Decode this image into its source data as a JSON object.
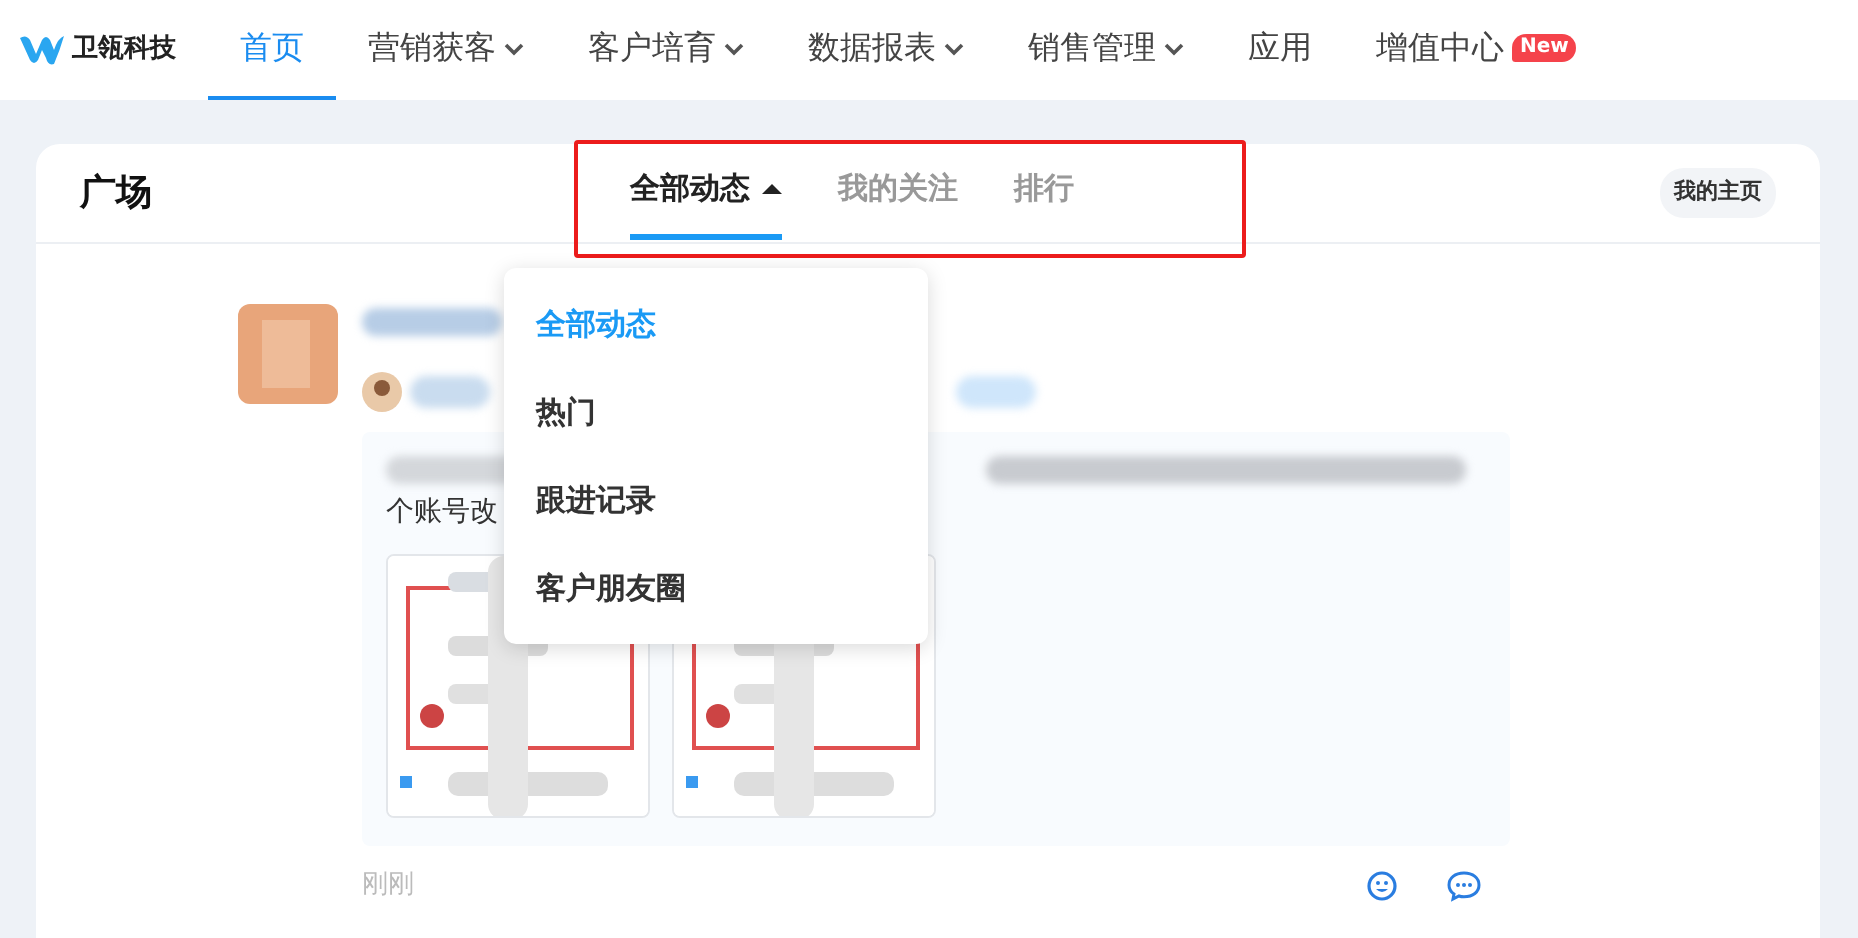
{
  "brand": {
    "name": "卫瓴科技"
  },
  "nav": [
    {
      "label": "首页",
      "selected": true,
      "has_caret": false
    },
    {
      "label": "营销获客",
      "selected": false,
      "has_caret": true
    },
    {
      "label": "客户培育",
      "selected": false,
      "has_caret": true
    },
    {
      "label": "数据报表",
      "selected": false,
      "has_caret": true
    },
    {
      "label": "销售管理",
      "selected": false,
      "has_caret": true
    },
    {
      "label": "应用",
      "selected": false,
      "has_caret": false
    },
    {
      "label": "增值中心",
      "selected": false,
      "has_caret": false,
      "badge": "New"
    }
  ],
  "panel": {
    "title": "广场",
    "home_button": "我的主页",
    "tabs": [
      {
        "label": "全部动态",
        "selected": true,
        "expanded": true
      },
      {
        "label": "我的关注",
        "selected": false
      },
      {
        "label": "排行",
        "selected": false
      }
    ],
    "dropdown": [
      {
        "label": "全部动态",
        "selected": true
      },
      {
        "label": "热门",
        "selected": false
      },
      {
        "label": "跟进记录",
        "selected": false
      },
      {
        "label": "客户朋友圈",
        "selected": false
      }
    ]
  },
  "post": {
    "content_fragment": "个账号改",
    "time": "刚刚"
  }
}
